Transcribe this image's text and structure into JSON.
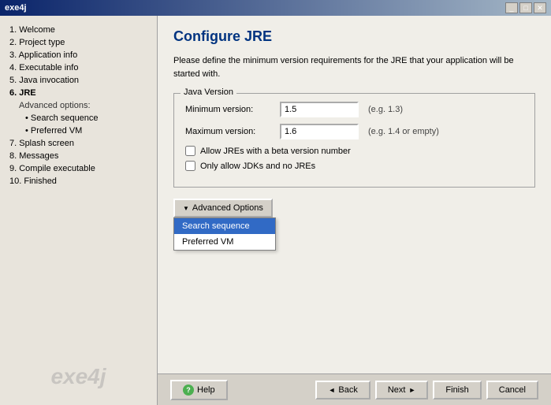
{
  "window": {
    "title": "exe4j"
  },
  "titlebar": {
    "controls": [
      "minimize",
      "maximize",
      "close"
    ]
  },
  "sidebar": {
    "items": [
      {
        "id": "welcome",
        "label": "1. Welcome",
        "active": false,
        "level": 0
      },
      {
        "id": "project-type",
        "label": "2. Project type",
        "active": false,
        "level": 0
      },
      {
        "id": "app-info",
        "label": "3. Application info",
        "active": false,
        "level": 0
      },
      {
        "id": "exe-info",
        "label": "4. Executable info",
        "active": false,
        "level": 0
      },
      {
        "id": "java-invocation",
        "label": "5. Java invocation",
        "active": false,
        "level": 0
      },
      {
        "id": "jre",
        "label": "6. JRE",
        "active": true,
        "level": 0
      },
      {
        "id": "advanced-options-label",
        "label": "Advanced options:",
        "active": false,
        "level": 1
      },
      {
        "id": "search-sequence",
        "label": "Search sequence",
        "active": false,
        "level": 2,
        "bullet": true
      },
      {
        "id": "preferred-vm",
        "label": "Preferred VM",
        "active": false,
        "level": 2,
        "bullet": true
      },
      {
        "id": "splash-screen",
        "label": "7. Splash screen",
        "active": false,
        "level": 0
      },
      {
        "id": "messages",
        "label": "8. Messages",
        "active": false,
        "level": 0
      },
      {
        "id": "compile-executable",
        "label": "9. Compile executable",
        "active": false,
        "level": 0
      },
      {
        "id": "finished",
        "label": "10. Finished",
        "active": false,
        "level": 0
      }
    ],
    "logo": "exe4j"
  },
  "content": {
    "title": "Configure JRE",
    "description": "Please define the minimum version requirements for the JRE that your application will be started with.",
    "java_version_group": "Java Version",
    "minimum_version_label": "Minimum version:",
    "minimum_version_value": "1.5",
    "minimum_version_hint": "(e.g. 1.3)",
    "maximum_version_label": "Maximum version:",
    "maximum_version_value": "1.6",
    "maximum_version_hint": "(e.g. 1.4 or empty)",
    "checkbox_beta_label": "Allow JREs with a beta version number",
    "checkbox_jdk_label": "Only allow JDKs and no JREs",
    "advanced_options_btn": "Advanced Options",
    "dropdown_items": [
      {
        "label": "Search sequence",
        "selected": true
      },
      {
        "label": "Preferred VM",
        "selected": false
      }
    ]
  },
  "footer": {
    "help_label": "Help",
    "back_label": "Back",
    "next_label": "Next",
    "finish_label": "Finish",
    "cancel_label": "Cancel"
  }
}
